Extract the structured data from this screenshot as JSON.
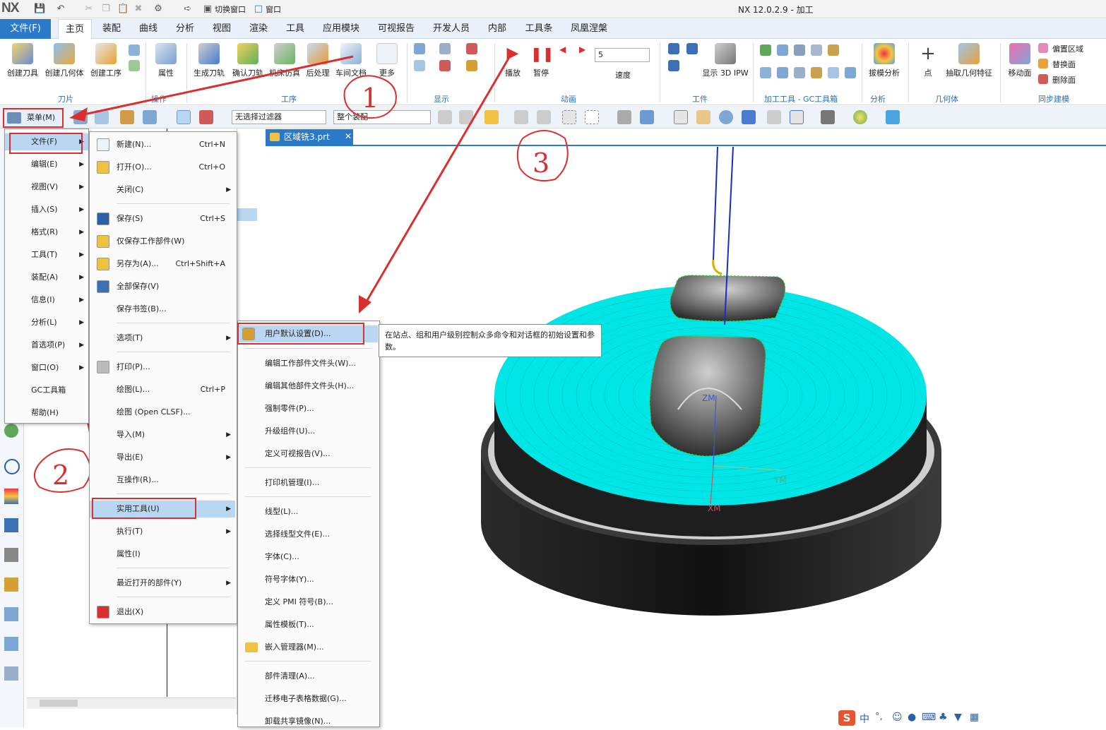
{
  "app": {
    "logo": "NX",
    "title": "NX 12.0.2.9 - 加工",
    "switch_window": "切换窗口",
    "window_menu": "窗口"
  },
  "tabs": [
    "文件(F)",
    "主页",
    "装配",
    "曲线",
    "分析",
    "视图",
    "渲染",
    "工具",
    "应用模块",
    "可视报告",
    "开发人员",
    "内部",
    "工具条",
    "凤凰涅槃"
  ],
  "ribbon": {
    "buttons": [
      "创建刀具",
      "创建几何体",
      "创建工序",
      "属性",
      "生成刀轨",
      "确认刀轨",
      "机床仿真",
      "后处理",
      "车间文档",
      "更多",
      "播放",
      "暂停",
      "速度",
      "显示 3D IPW",
      "拔模分析",
      "点",
      "抽取几何特征",
      "移动面"
    ],
    "right_small": [
      "偏置区域",
      "替换面",
      "删除面"
    ],
    "speed_value": "5",
    "groups": [
      "刀片",
      "操作",
      "工序",
      "显示",
      "动画",
      "工件",
      "加工工具 - GC工具箱",
      "分析",
      "几何体",
      "同步建模"
    ]
  },
  "toolbar2": {
    "menu_label": "菜单(M)",
    "filter": "无选择过滤器",
    "scope": "整个装配"
  },
  "viewport": {
    "tab_label": "区域铣3.prt",
    "axis_zm": "ZM",
    "axis_ym": "YM",
    "axis_xm": "XM"
  },
  "main_menu": [
    "文件(F)",
    "编辑(E)",
    "视图(V)",
    "插入(S)",
    "格式(R)",
    "工具(T)",
    "装配(A)",
    "信息(I)",
    "分析(L)",
    "首选项(P)",
    "窗口(O)",
    "GC工具箱",
    "帮助(H)"
  ],
  "file_menu": [
    {
      "label": "新建(N)...",
      "shortcut": "Ctrl+N"
    },
    {
      "label": "打开(O)...",
      "shortcut": "Ctrl+O"
    },
    {
      "label": "关闭(C)",
      "shortcut": ""
    },
    {
      "label": "保存(S)",
      "shortcut": "Ctrl+S"
    },
    {
      "label": "仅保存工作部件(W)",
      "shortcut": ""
    },
    {
      "label": "另存为(A)...",
      "shortcut": "Ctrl+Shift+A"
    },
    {
      "label": "全部保存(V)",
      "shortcut": ""
    },
    {
      "label": "保存书签(B)...",
      "shortcut": ""
    },
    {
      "label": "选项(T)",
      "shortcut": ""
    },
    {
      "label": "打印(P)...",
      "shortcut": ""
    },
    {
      "label": "绘图(L)...",
      "shortcut": "Ctrl+P"
    },
    {
      "label": "绘图 (Open CLSF)...",
      "shortcut": ""
    },
    {
      "label": "导入(M)",
      "shortcut": ""
    },
    {
      "label": "导出(E)",
      "shortcut": ""
    },
    {
      "label": "互操作(R)...",
      "shortcut": ""
    },
    {
      "label": "实用工具(U)",
      "shortcut": ""
    },
    {
      "label": "执行(T)",
      "shortcut": ""
    },
    {
      "label": "属性(I)",
      "shortcut": ""
    },
    {
      "label": "最近打开的部件(Y)",
      "shortcut": ""
    },
    {
      "label": "退出(X)",
      "shortcut": ""
    }
  ],
  "util_menu": [
    "用户默认设置(D)...",
    "编辑工作部件文件头(W)...",
    "编辑其他部件文件头(H)...",
    "强制零件(P)...",
    "升级组件(U)...",
    "定义可视报告(V)...",
    "打印机管理(I)...",
    "线型(L)...",
    "选择线型文件(E)...",
    "字体(C)...",
    "符号字体(Y)...",
    "定义 PMI 符号(B)...",
    "属性模板(T)...",
    "嵌入管理器(M)...",
    "部件清理(A)...",
    "迁移电子表格数据(G)...",
    "卸载共享镜像(N)..."
  ],
  "tooltip": "在站点、组和用户级别控制众多命令和对话框的初始设置和参数。",
  "annotations": [
    "1",
    "2",
    "3"
  ],
  "status": {
    "ime": "中"
  },
  "colors": {
    "accent": "#2b7ac9",
    "annotation": "#d9302f",
    "toolpath": "#00e5e5"
  }
}
